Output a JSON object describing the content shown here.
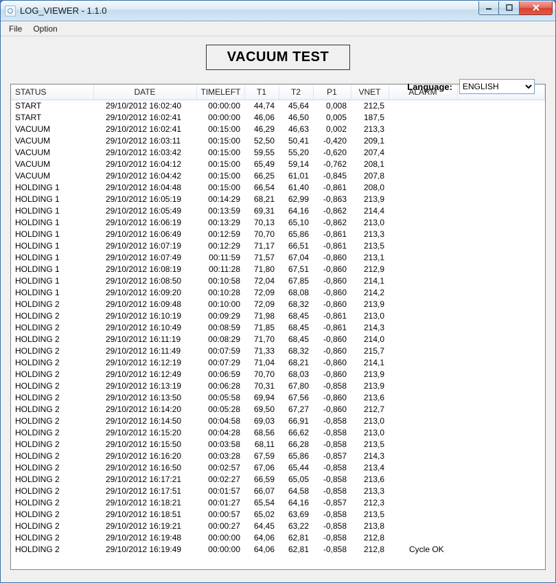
{
  "window": {
    "title": "LOG_VIEWER - 1.1.0"
  },
  "menu": {
    "file": "File",
    "option": "Option"
  },
  "heading": "VACUUM TEST",
  "language": {
    "label": "Language:",
    "selected": "ENGLISH"
  },
  "columns": {
    "status": "STATUS",
    "date": "DATE",
    "timeleft": "TIMELEFT",
    "t1": "T1",
    "t2": "T2",
    "p1": "P1",
    "vnet": "VNET",
    "alarm": "ALARM"
  },
  "rows": [
    {
      "status": "START",
      "date": "29/10/2012 16:02:40",
      "timeleft": "00:00:00",
      "t1": "44,74",
      "t2": "45,64",
      "p1": "0,008",
      "vnet": "212,5",
      "alarm": ""
    },
    {
      "status": "START",
      "date": "29/10/2012 16:02:41",
      "timeleft": "00:00:00",
      "t1": "46,06",
      "t2": "46,50",
      "p1": "0,005",
      "vnet": "187,5",
      "alarm": ""
    },
    {
      "status": "VACUUM",
      "date": "29/10/2012 16:02:41",
      "timeleft": "00:15:00",
      "t1": "46,29",
      "t2": "46,63",
      "p1": "0,002",
      "vnet": "213,3",
      "alarm": ""
    },
    {
      "status": "VACUUM",
      "date": "29/10/2012 16:03:11",
      "timeleft": "00:15:00",
      "t1": "52,50",
      "t2": "50,41",
      "p1": "-0,420",
      "vnet": "209,1",
      "alarm": ""
    },
    {
      "status": "VACUUM",
      "date": "29/10/2012 16:03:42",
      "timeleft": "00:15:00",
      "t1": "59,55",
      "t2": "55,20",
      "p1": "-0,620",
      "vnet": "207,4",
      "alarm": ""
    },
    {
      "status": "VACUUM",
      "date": "29/10/2012 16:04:12",
      "timeleft": "00:15:00",
      "t1": "65,49",
      "t2": "59,14",
      "p1": "-0,762",
      "vnet": "208,1",
      "alarm": ""
    },
    {
      "status": "VACUUM",
      "date": "29/10/2012 16:04:42",
      "timeleft": "00:15:00",
      "t1": "66,25",
      "t2": "61,01",
      "p1": "-0,845",
      "vnet": "207,8",
      "alarm": ""
    },
    {
      "status": "HOLDING 1",
      "date": "29/10/2012 16:04:48",
      "timeleft": "00:15:00",
      "t1": "66,54",
      "t2": "61,40",
      "p1": "-0,861",
      "vnet": "208,0",
      "alarm": ""
    },
    {
      "status": "HOLDING 1",
      "date": "29/10/2012 16:05:19",
      "timeleft": "00:14:29",
      "t1": "68,21",
      "t2": "62,99",
      "p1": "-0,863",
      "vnet": "213,9",
      "alarm": ""
    },
    {
      "status": "HOLDING 1",
      "date": "29/10/2012 16:05:49",
      "timeleft": "00:13:59",
      "t1": "69,31",
      "t2": "64,16",
      "p1": "-0,862",
      "vnet": "214,4",
      "alarm": ""
    },
    {
      "status": "HOLDING 1",
      "date": "29/10/2012 16:06:19",
      "timeleft": "00:13:29",
      "t1": "70,13",
      "t2": "65,10",
      "p1": "-0,862",
      "vnet": "213,0",
      "alarm": ""
    },
    {
      "status": "HOLDING 1",
      "date": "29/10/2012 16:06:49",
      "timeleft": "00:12:59",
      "t1": "70,70",
      "t2": "65,86",
      "p1": "-0,861",
      "vnet": "213,3",
      "alarm": ""
    },
    {
      "status": "HOLDING 1",
      "date": "29/10/2012 16:07:19",
      "timeleft": "00:12:29",
      "t1": "71,17",
      "t2": "66,51",
      "p1": "-0,861",
      "vnet": "213,5",
      "alarm": ""
    },
    {
      "status": "HOLDING 1",
      "date": "29/10/2012 16:07:49",
      "timeleft": "00:11:59",
      "t1": "71,57",
      "t2": "67,04",
      "p1": "-0,860",
      "vnet": "213,1",
      "alarm": ""
    },
    {
      "status": "HOLDING 1",
      "date": "29/10/2012 16:08:19",
      "timeleft": "00:11:28",
      "t1": "71,80",
      "t2": "67,51",
      "p1": "-0,860",
      "vnet": "212,9",
      "alarm": ""
    },
    {
      "status": "HOLDING 1",
      "date": "29/10/2012 16:08:50",
      "timeleft": "00:10:58",
      "t1": "72,04",
      "t2": "67,85",
      "p1": "-0,860",
      "vnet": "214,1",
      "alarm": ""
    },
    {
      "status": "HOLDING 1",
      "date": "29/10/2012 16:09:20",
      "timeleft": "00:10:28",
      "t1": "72,09",
      "t2": "68,08",
      "p1": "-0,860",
      "vnet": "214,2",
      "alarm": ""
    },
    {
      "status": "HOLDING 2",
      "date": "29/10/2012 16:09:48",
      "timeleft": "00:10:00",
      "t1": "72,09",
      "t2": "68,32",
      "p1": "-0,860",
      "vnet": "213,9",
      "alarm": ""
    },
    {
      "status": "HOLDING 2",
      "date": "29/10/2012 16:10:19",
      "timeleft": "00:09:29",
      "t1": "71,98",
      "t2": "68,45",
      "p1": "-0,861",
      "vnet": "213,0",
      "alarm": ""
    },
    {
      "status": "HOLDING 2",
      "date": "29/10/2012 16:10:49",
      "timeleft": "00:08:59",
      "t1": "71,85",
      "t2": "68,45",
      "p1": "-0,861",
      "vnet": "214,3",
      "alarm": ""
    },
    {
      "status": "HOLDING 2",
      "date": "29/10/2012 16:11:19",
      "timeleft": "00:08:29",
      "t1": "71,70",
      "t2": "68,45",
      "p1": "-0,860",
      "vnet": "214,0",
      "alarm": ""
    },
    {
      "status": "HOLDING 2",
      "date": "29/10/2012 16:11:49",
      "timeleft": "00:07:59",
      "t1": "71,33",
      "t2": "68,32",
      "p1": "-0,860",
      "vnet": "215,7",
      "alarm": ""
    },
    {
      "status": "HOLDING 2",
      "date": "29/10/2012 16:12:19",
      "timeleft": "00:07:29",
      "t1": "71,04",
      "t2": "68,21",
      "p1": "-0,860",
      "vnet": "214,1",
      "alarm": ""
    },
    {
      "status": "HOLDING 2",
      "date": "29/10/2012 16:12:49",
      "timeleft": "00:06:59",
      "t1": "70,70",
      "t2": "68,03",
      "p1": "-0,860",
      "vnet": "213,9",
      "alarm": ""
    },
    {
      "status": "HOLDING 2",
      "date": "29/10/2012 16:13:19",
      "timeleft": "00:06:28",
      "t1": "70,31",
      "t2": "67,80",
      "p1": "-0,858",
      "vnet": "213,9",
      "alarm": ""
    },
    {
      "status": "HOLDING 2",
      "date": "29/10/2012 16:13:50",
      "timeleft": "00:05:58",
      "t1": "69,94",
      "t2": "67,56",
      "p1": "-0,860",
      "vnet": "213,6",
      "alarm": ""
    },
    {
      "status": "HOLDING 2",
      "date": "29/10/2012 16:14:20",
      "timeleft": "00:05:28",
      "t1": "69,50",
      "t2": "67,27",
      "p1": "-0,860",
      "vnet": "212,7",
      "alarm": ""
    },
    {
      "status": "HOLDING 2",
      "date": "29/10/2012 16:14:50",
      "timeleft": "00:04:58",
      "t1": "69,03",
      "t2": "66,91",
      "p1": "-0,858",
      "vnet": "213,0",
      "alarm": ""
    },
    {
      "status": "HOLDING 2",
      "date": "29/10/2012 16:15:20",
      "timeleft": "00:04:28",
      "t1": "68,56",
      "t2": "66,62",
      "p1": "-0,858",
      "vnet": "213,0",
      "alarm": ""
    },
    {
      "status": "HOLDING 2",
      "date": "29/10/2012 16:15:50",
      "timeleft": "00:03:58",
      "t1": "68,11",
      "t2": "66,28",
      "p1": "-0,858",
      "vnet": "213,5",
      "alarm": ""
    },
    {
      "status": "HOLDING 2",
      "date": "29/10/2012 16:16:20",
      "timeleft": "00:03:28",
      "t1": "67,59",
      "t2": "65,86",
      "p1": "-0,857",
      "vnet": "214,3",
      "alarm": ""
    },
    {
      "status": "HOLDING 2",
      "date": "29/10/2012 16:16:50",
      "timeleft": "00:02:57",
      "t1": "67,06",
      "t2": "65,44",
      "p1": "-0,858",
      "vnet": "213,4",
      "alarm": ""
    },
    {
      "status": "HOLDING 2",
      "date": "29/10/2012 16:17:21",
      "timeleft": "00:02:27",
      "t1": "66,59",
      "t2": "65,05",
      "p1": "-0,858",
      "vnet": "213,6",
      "alarm": ""
    },
    {
      "status": "HOLDING 2",
      "date": "29/10/2012 16:17:51",
      "timeleft": "00:01:57",
      "t1": "66,07",
      "t2": "64,58",
      "p1": "-0,858",
      "vnet": "213,3",
      "alarm": ""
    },
    {
      "status": "HOLDING 2",
      "date": "29/10/2012 16:18:21",
      "timeleft": "00:01:27",
      "t1": "65,54",
      "t2": "64,16",
      "p1": "-0,857",
      "vnet": "212,3",
      "alarm": ""
    },
    {
      "status": "HOLDING 2",
      "date": "29/10/2012 16:18:51",
      "timeleft": "00:00:57",
      "t1": "65,02",
      "t2": "63,69",
      "p1": "-0,858",
      "vnet": "213,5",
      "alarm": ""
    },
    {
      "status": "HOLDING 2",
      "date": "29/10/2012 16:19:21",
      "timeleft": "00:00:27",
      "t1": "64,45",
      "t2": "63,22",
      "p1": "-0,858",
      "vnet": "213,8",
      "alarm": ""
    },
    {
      "status": "HOLDING 2",
      "date": "29/10/2012 16:19:48",
      "timeleft": "00:00:00",
      "t1": "64,06",
      "t2": "62,81",
      "p1": "-0,858",
      "vnet": "212,8",
      "alarm": ""
    },
    {
      "status": "HOLDING 2",
      "date": "29/10/2012 16:19:49",
      "timeleft": "00:00:00",
      "t1": "64,06",
      "t2": "62,81",
      "p1": "-0,858",
      "vnet": "212,8",
      "alarm": "Cycle OK"
    }
  ]
}
